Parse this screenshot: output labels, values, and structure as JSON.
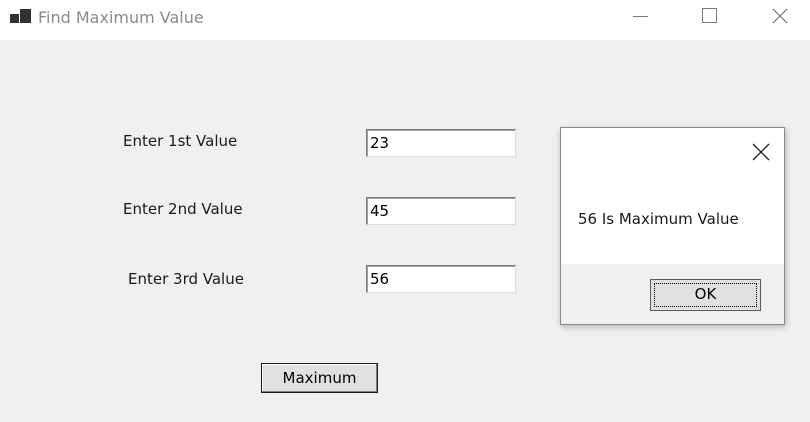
{
  "window": {
    "title": "Find Maximum Value"
  },
  "icons": {
    "app": "app-icon",
    "minimize": "minimize-icon",
    "maximize": "maximize-icon",
    "close": "close-icon"
  },
  "form": {
    "fields": [
      {
        "label": "Enter 1st Value",
        "value": "23"
      },
      {
        "label": "Enter 2nd Value",
        "value": "45"
      },
      {
        "label": "Enter 3rd Value",
        "value": "56"
      }
    ],
    "maximum_button": "Maximum"
  },
  "message_box": {
    "text": "56 Is Maximum Value",
    "ok_label": "OK"
  }
}
